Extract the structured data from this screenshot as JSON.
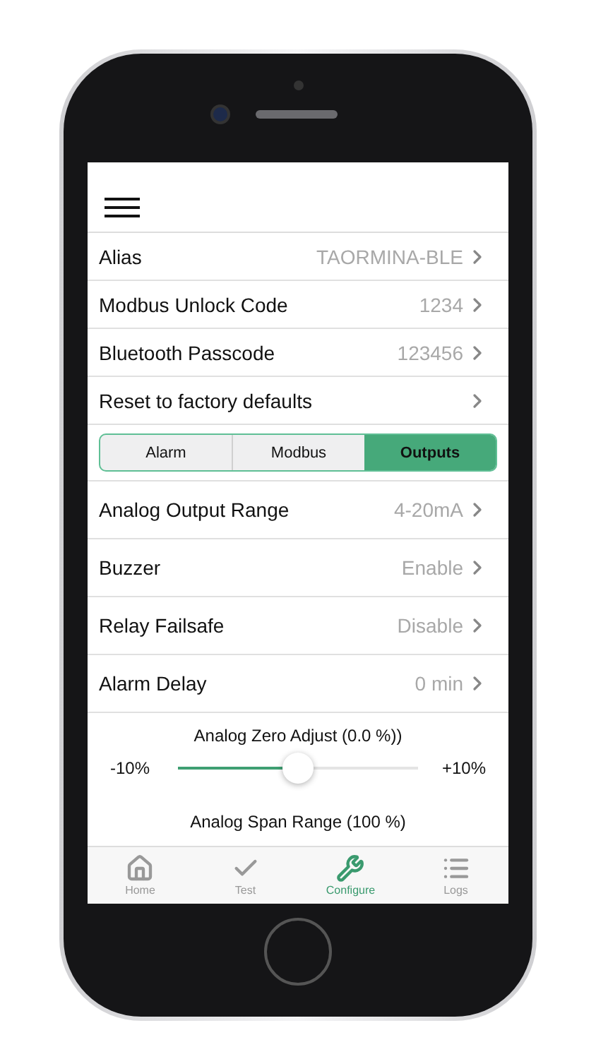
{
  "settings_top": [
    {
      "label": "Alias",
      "value": "TAORMINA-BLE"
    },
    {
      "label": "Modbus Unlock Code",
      "value": "1234"
    },
    {
      "label": "Bluetooth Passcode",
      "value": "123456"
    },
    {
      "label": "Reset to factory defaults"
    }
  ],
  "segments": [
    {
      "label": "Alarm",
      "selected": false
    },
    {
      "label": "Modbus",
      "selected": false
    },
    {
      "label": "Outputs",
      "selected": true
    }
  ],
  "settings_outputs": [
    {
      "label": "Analog Output Range",
      "value": "4-20mA"
    },
    {
      "label": "Buzzer",
      "value": "Enable"
    },
    {
      "label": "Relay Failsafe",
      "value": "Disable"
    },
    {
      "label": "Alarm Delay",
      "value": "0 min"
    }
  ],
  "zero_slider": {
    "title": "Analog Zero Adjust (0.0 %))",
    "min_label": "-10%",
    "max_label": "+10%",
    "level": 0.5
  },
  "span_slider": {
    "title": "Analog Span Range (100 %)"
  },
  "tab_bar": [
    {
      "label": "Home",
      "selected": false
    },
    {
      "label": "Test",
      "selected": false
    },
    {
      "label": "Configure",
      "selected": true
    },
    {
      "label": "Logs",
      "selected": false
    }
  ]
}
